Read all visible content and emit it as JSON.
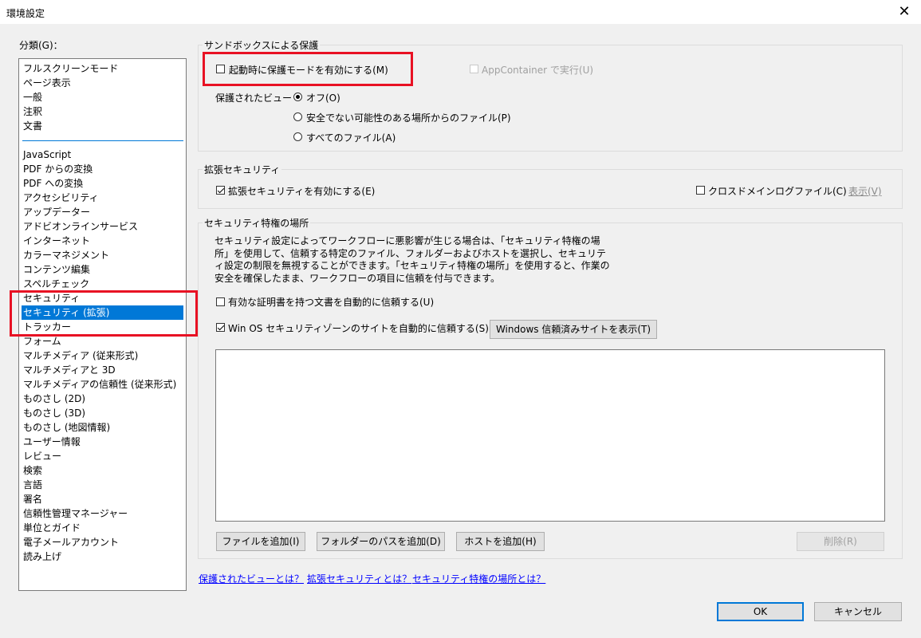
{
  "window": {
    "title": "環境設定",
    "close_glyph": "✕"
  },
  "sidebar": {
    "label": "分類(G)：",
    "items_top": [
      "フルスクリーンモード",
      "ページ表示",
      "一般",
      "注釈",
      "文書"
    ],
    "items": [
      "JavaScript",
      "PDF からの変換",
      "PDF への変換",
      "アクセシビリティ",
      "アップデーター",
      "アドビオンラインサービス",
      "インターネット",
      "カラーマネジメント",
      "コンテンツ編集",
      "スペルチェック",
      "セキュリティ",
      "セキュリティ (拡張)",
      "トラッカー",
      "フォーム",
      "マルチメディア (従来形式)",
      "マルチメディアと 3D",
      "マルチメディアの信頼性 (従来形式)",
      "ものさし (2D)",
      "ものさし (3D)",
      "ものさし (地図情報)",
      "ユーザー情報",
      "レビュー",
      "検索",
      "言語",
      "署名",
      "信頼性管理マネージャー",
      "単位とガイド",
      "電子メールアカウント",
      "読み上げ"
    ],
    "selected": "セキュリティ (拡張)"
  },
  "sandbox": {
    "title": "サンドボックスによる保護",
    "protected_mode_label": "起動時に保護モードを有効にする(M)",
    "protected_mode_checked": false,
    "appcontainer_label": "AppContainer で実行(U)",
    "appcontainer_checked": false,
    "protected_view_label": "保護されたビュー",
    "protected_view_options": [
      "オフ(O)",
      "安全でない可能性のある場所からのファイル(P)",
      "すべてのファイル(A)"
    ],
    "protected_view_selected": "オフ(O)"
  },
  "enhanced": {
    "title": "拡張セキュリティ",
    "enable_label": "拡張セキュリティを有効にする(E)",
    "enable_checked": true,
    "crossdomain_label": "クロスドメインログファイル(C)",
    "crossdomain_checked": false,
    "view_link": "表示(V)"
  },
  "privileged": {
    "title": "セキュリティ特権の場所",
    "description": "セキュリティ設定によってワークフローに悪影響が生じる場合は、「セキュリティ特権の場所」を使用して、信頼する特定のファイル、フォルダーおよびホストを選択し、セキュリティ設定の制限を無視することができます。「セキュリティ特権の場所」を使用すると、作業の安全を確保したまま、ワークフローの項目に信頼を付与できます。",
    "trust_certified_label": "有効な証明書を持つ文書を自動的に信頼する(U)",
    "trust_certified_checked": false,
    "trust_winos_label": "Win OS セキュリティゾーンのサイトを自動的に信頼する(S)",
    "trust_winos_checked": true,
    "show_trusted_sites_button": "Windows 信頼済みサイトを表示(T)",
    "add_file_button": "ファイルを追加(I)",
    "add_folder_button": "フォルダーのパスを追加(D)",
    "add_host_button": "ホストを追加(H)",
    "remove_button": "削除(R)"
  },
  "links": {
    "protected_view": "保護されたビューとは？",
    "enhanced": "拡張セキュリティとは？",
    "privileged": "セキュリティ特権の場所とは？"
  },
  "footer": {
    "ok": "OK",
    "cancel": "キャンセル"
  },
  "colors": {
    "highlight": "#e81123",
    "selection": "#0078d7",
    "link": "#0000ff"
  }
}
